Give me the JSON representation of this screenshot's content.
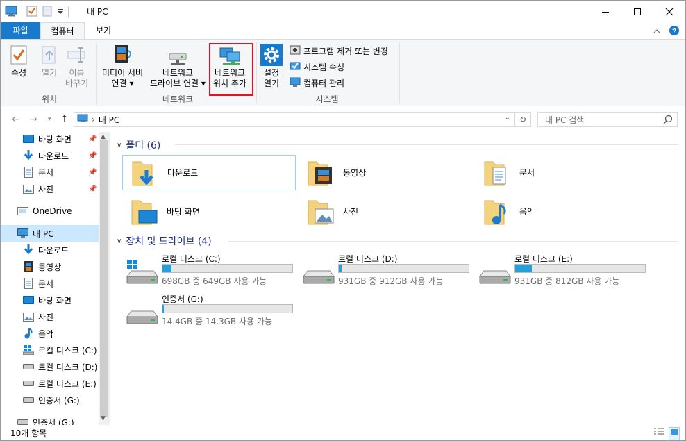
{
  "window": {
    "title": "내 PC"
  },
  "tabs": {
    "file": "파일",
    "computer": "컴퓨터",
    "view": "보기"
  },
  "ribbon": {
    "location": {
      "properties": "속성",
      "open": "열기",
      "rename_l1": "이름",
      "rename_l2": "바꾸기",
      "group": "위치"
    },
    "network": {
      "media_l1": "미디어 서버",
      "media_l2": "연결",
      "map_l1": "네트워크",
      "map_l2": "드라이브 연결",
      "add_l1": "네트워크",
      "add_l2": "위치 추가",
      "group": "네트워크"
    },
    "system": {
      "settings_l1": "설정",
      "settings_l2": "열기",
      "uninstall": "프로그램 제거 또는 변경",
      "sysprops": "시스템 속성",
      "manage": "컴퓨터 관리",
      "group": "시스템"
    }
  },
  "address": {
    "path": "내 PC",
    "search_placeholder": "내 PC 검색"
  },
  "nav": {
    "quick": [
      "바탕 화면",
      "다운로드",
      "문서",
      "사진"
    ],
    "onedrive": "OneDrive",
    "thispc": "내 PC",
    "pc_items": [
      "다운로드",
      "동영상",
      "문서",
      "바탕 화면",
      "사진",
      "음악",
      "로컬 디스크 (C:)",
      "로컬 디스크 (D:)",
      "로컬 디스크 (E:)",
      "인증서 (G:)"
    ],
    "extra": "인증서 (G:)"
  },
  "folders": {
    "header": "폴더 (6)",
    "items": [
      "다운로드",
      "동영상",
      "문서",
      "바탕 화면",
      "사진",
      "음악"
    ]
  },
  "drives": {
    "header": "장치 및 드라이브 (4)",
    "items": [
      {
        "name": "로컬 디스크 (C:)",
        "free": "698GB 중 649GB 사용 가능",
        "used_fraction": 0.07
      },
      {
        "name": "로컬 디스크 (D:)",
        "free": "931GB 중 912GB 사용 가능",
        "used_fraction": 0.02
      },
      {
        "name": "로컬 디스크 (E:)",
        "free": "931GB 중 812GB 사용 가능",
        "used_fraction": 0.13
      },
      {
        "name": "인증서 (G:)",
        "free": "14.4GB 중 14.3GB 사용 가능",
        "used_fraction": 0.01
      }
    ]
  },
  "status": {
    "count": "10개 항목"
  },
  "colors": {
    "accent": "#1979ca",
    "selection": "#cce8ff",
    "drive_fill": "#26a0da",
    "highlight": "#e81123",
    "section": "#1e3287"
  }
}
